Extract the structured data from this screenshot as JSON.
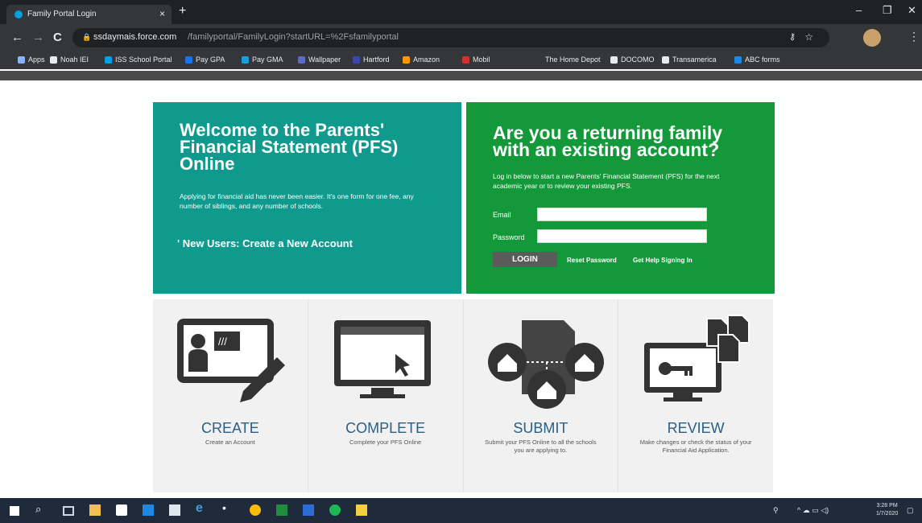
{
  "browser": {
    "tab_title": "Family Portal Login",
    "tab_close": "×",
    "new_tab": "+",
    "minimize": "–",
    "restore": "❐",
    "close": "✕",
    "back": "←",
    "forward": "→",
    "reload": "C",
    "url_host": "ssdaymais.force.com",
    "url_path": "/familyportal/FamilyLogin?startURL=%2Fsfamilyportal",
    "bookmarks": [
      {
        "label": "Apps",
        "color": "#8ab4f8"
      },
      {
        "label": "Noah IEI",
        "color": "#e8eaed"
      },
      {
        "label": "ISS School Portal",
        "color": "#00a1e0"
      },
      {
        "label": "Pay GPA",
        "color": "#1a73e8"
      },
      {
        "label": "Pay GMA",
        "color": "#1a9fd8"
      },
      {
        "label": "Wallpaper",
        "color": "#5c6bc0"
      },
      {
        "label": "Hartford",
        "color": "#3949ab"
      },
      {
        "label": "Amazon",
        "color": "#ff9900"
      },
      {
        "label": "Mobil",
        "color": "#d32f2f"
      },
      {
        "label": "The Home Depot",
        "color": "#35363a"
      },
      {
        "label": "DOCOMO",
        "color": "#e8eaed"
      },
      {
        "label": "Transamerica",
        "color": "#e8eaed"
      },
      {
        "label": "ABC forms",
        "color": "#1e88e5"
      }
    ]
  },
  "welcome": {
    "title": "Welcome to the Parents' Financial Statement (PFS) Online",
    "description": "Applying for financial aid has never been easier. It's one form for one fee, any number of siblings, and any number of schools.",
    "new_users_link": "' New Users: Create a New Account"
  },
  "login": {
    "title": "Are you a returning family with an existing account?",
    "description": "Log in below to start a new Parents' Financial Statement (PFS) for the next academic year or to review your existing PFS.",
    "email_label": "Email",
    "email_value": "",
    "password_label": "Password",
    "password_value": "",
    "login_button": "LOGIN",
    "reset_password": "Reset Password",
    "get_help": "Get Help Signing In"
  },
  "steps": [
    {
      "title": "CREATE",
      "description": "Create an Account",
      "icon": "create-account-icon"
    },
    {
      "title": "COMPLETE",
      "description": "Complete your PFS Online",
      "icon": "computer-screen-icon"
    },
    {
      "title": "SUBMIT",
      "description": "Submit your PFS Online to all the schools you are applying to.",
      "icon": "submit-schools-icon"
    },
    {
      "title": "REVIEW",
      "description": "Make changes or check the status of your Financial Aid Application.",
      "icon": "review-documents-icon"
    }
  ],
  "taskbar": {
    "time": "3:28 PM",
    "date": "1/7/2020"
  },
  "colors": {
    "teal_panel": "#0f9a8d",
    "green_panel": "#13993a",
    "step_title": "#2a5f86"
  }
}
